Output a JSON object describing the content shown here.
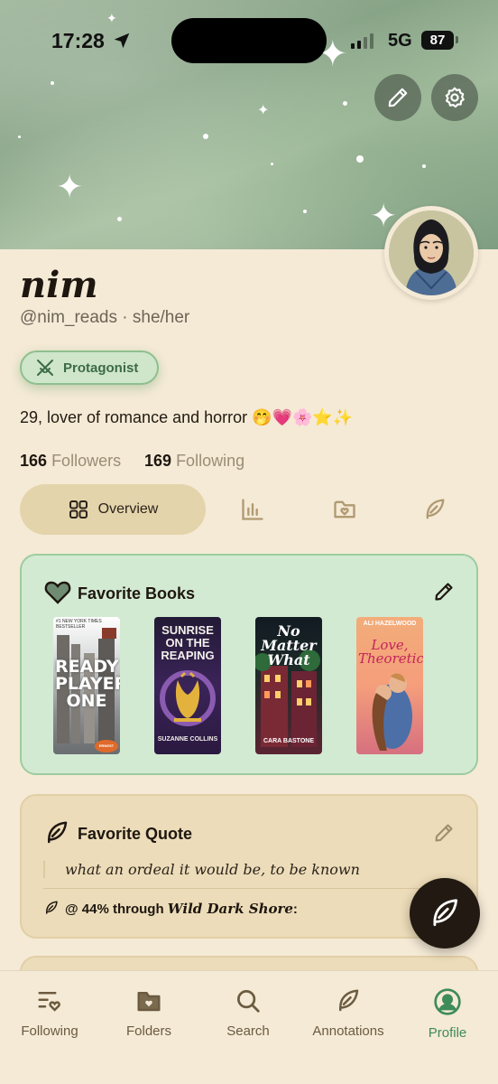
{
  "status_bar": {
    "time": "17:28",
    "network": "5G",
    "battery": "87"
  },
  "profile": {
    "name": "nim",
    "handle_line": "@nim_reads · she/her",
    "badge": "Protagonist",
    "bio": "29, lover of romance and horror 🤭💗🌸⭐✨",
    "followers_count": "166",
    "followers_label": "Followers",
    "following_count": "169",
    "following_label": "Following"
  },
  "tabs": {
    "active_label": "Overview"
  },
  "favorite_books": {
    "title": "Favorite Books",
    "books": [
      {
        "top": "#1 NEW YORK TIMES BESTSELLER",
        "title": "READY PLAYER ONE",
        "author": "ERNEST CLINE"
      },
      {
        "title": "SUNRISE ON THE REAPING",
        "author": "SUZANNE COLLINS"
      },
      {
        "title": "No Matter What",
        "author": "CARA BASTONE"
      },
      {
        "title": "Love, Theoretically",
        "author": "ALI HAZELWOOD"
      }
    ]
  },
  "favorite_quote": {
    "title": "Favorite Quote",
    "quote": "what an ordeal it would be, to be known",
    "progress_prefix": "@ 44% through ",
    "progress_book": "Wild Dark Shore",
    "progress_suffix": ":"
  },
  "bottom_nav": {
    "items": [
      {
        "label": "Following"
      },
      {
        "label": "Folders"
      },
      {
        "label": "Search"
      },
      {
        "label": "Annotations"
      },
      {
        "label": "Profile"
      }
    ]
  },
  "colors": {
    "accent": "#3f8b5a",
    "card_green": "#d3ead2",
    "card_tan": "#ecdcb9",
    "background": "#f5ead6"
  }
}
